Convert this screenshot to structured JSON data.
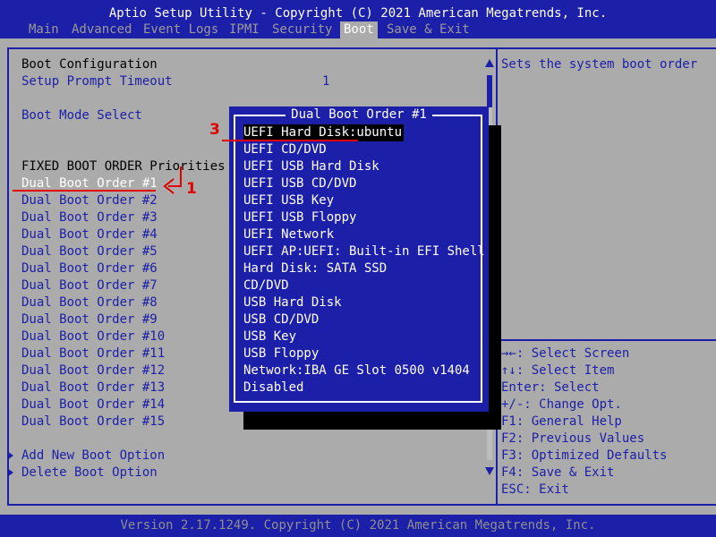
{
  "header": {
    "title": "Aptio Setup Utility - Copyright (C) 2021 American Megatrends, Inc.",
    "tabs": [
      "Main",
      "Advanced",
      "Event Logs",
      "IPMI",
      "Security",
      "Boot",
      "Save & Exit"
    ],
    "active_tab": "Boot"
  },
  "left": {
    "section_title": "Boot Configuration",
    "setup_prompt_label": "Setup Prompt Timeout",
    "setup_prompt_value": "1",
    "boot_mode_label": "Boot Mode Select",
    "fixed_title": "FIXED BOOT ORDER Priorities",
    "boot_orders": [
      "Dual Boot Order #1",
      "Dual Boot Order #2",
      "Dual Boot Order #3",
      "Dual Boot Order #4",
      "Dual Boot Order #5",
      "Dual Boot Order #6",
      "Dual Boot Order #7",
      "Dual Boot Order #8",
      "Dual Boot Order #9",
      "Dual Boot Order #10",
      "Dual Boot Order #11",
      "Dual Boot Order #12",
      "Dual Boot Order #13",
      "Dual Boot Order #14",
      "Dual Boot Order #15"
    ],
    "add_option": "Add New Boot Option",
    "delete_option": "Delete Boot Option"
  },
  "popup": {
    "title": "Dual Boot Order #1",
    "options": [
      "UEFI Hard Disk:ubuntu",
      "UEFI CD/DVD",
      "UEFI USB Hard Disk",
      "UEFI USB CD/DVD",
      "UEFI USB Key",
      "UEFI USB Floppy",
      "UEFI Network",
      "UEFI AP:UEFI: Built-in EFI Shell",
      "Hard Disk: SATA SSD",
      "CD/DVD",
      "USB Hard Disk",
      "USB CD/DVD",
      "USB Key",
      "USB Floppy",
      "Network:IBA GE Slot 0500 v1404",
      "Disabled"
    ]
  },
  "help": {
    "description": "Sets the system boot order",
    "keys": [
      "→←: Select Screen",
      "↑↓: Select Item",
      "Enter: Select",
      "+/-: Change Opt.",
      "F1: General Help",
      "F2: Previous Values",
      "F3: Optimized Defaults",
      "F4: Save & Exit",
      "ESC: Exit"
    ]
  },
  "annotations": {
    "marker_1": "1",
    "marker_3": "3"
  },
  "footer": {
    "version": "Version 2.17.1249. Copyright (C) 2021 American Megatrends, Inc."
  },
  "colors": {
    "bios_blue": "#1c1fa7",
    "background_gray": "#ababab",
    "annotation_red": "#e00000"
  },
  "icons": {
    "submenu_marker": "triangle-right-icon",
    "scroll_up": "triangle-up-icon",
    "scroll_down": "triangle-down-icon"
  }
}
